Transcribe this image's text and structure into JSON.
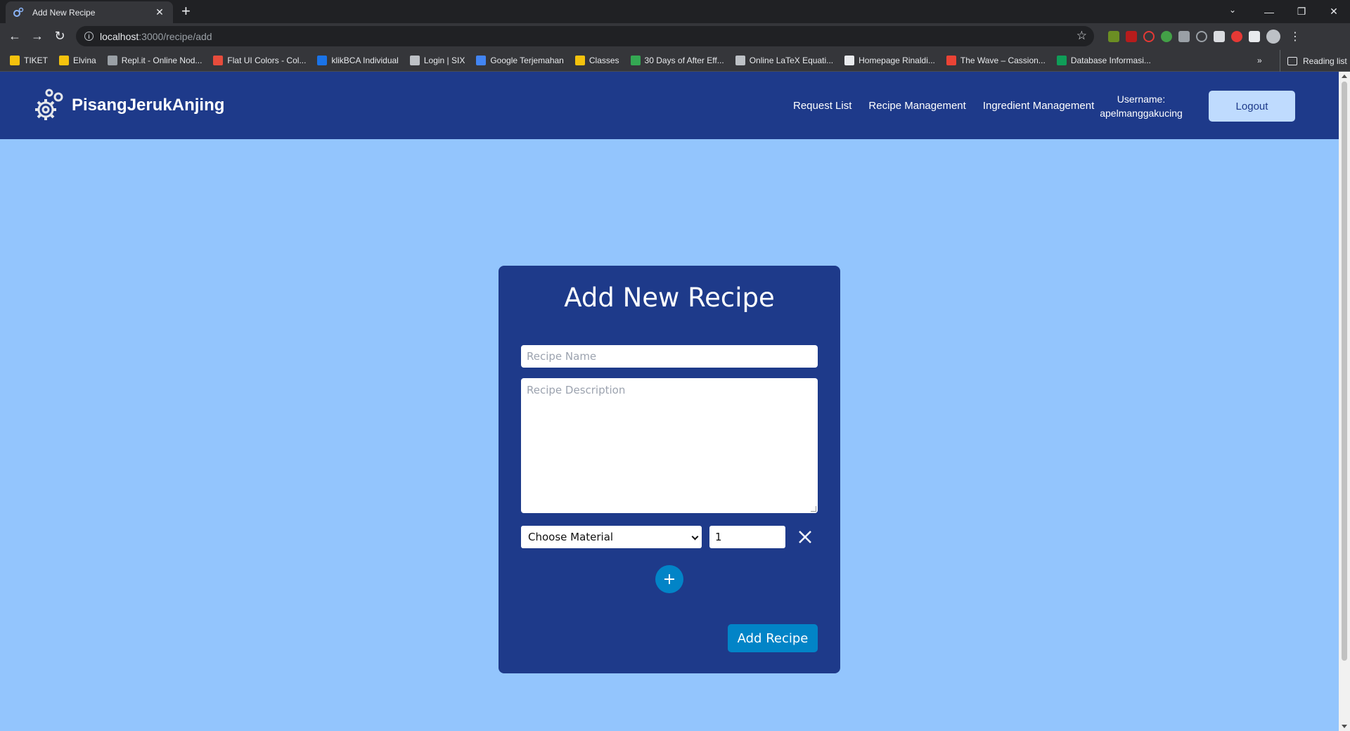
{
  "browser": {
    "tab_title": "Add New Recipe",
    "url_host": "localhost",
    "url_path": ":3000/recipe/add",
    "bookmarks": [
      {
        "label": "TIKET",
        "color": "#f4c20d"
      },
      {
        "label": "Elvina",
        "color": "#f4c20d"
      },
      {
        "label": "Repl.it - Online Nod...",
        "color": "#9aa0a6"
      },
      {
        "label": "Flat UI Colors - Col...",
        "color": "#e74c3c"
      },
      {
        "label": "klikBCA Individual",
        "color": "#1a73e8"
      },
      {
        "label": "Login | SIX",
        "color": "#bdc1c6"
      },
      {
        "label": "Google Terjemahan",
        "color": "#4285f4"
      },
      {
        "label": "Classes",
        "color": "#f4c20d"
      },
      {
        "label": "30 Days of After Eff...",
        "color": "#34a853"
      },
      {
        "label": "Online LaTeX Equati...",
        "color": "#bdc1c6"
      },
      {
        "label": "Homepage Rinaldi...",
        "color": "#e8eaed"
      },
      {
        "label": "The Wave – Cassion...",
        "color": "#ea4335"
      },
      {
        "label": "Database Informasi...",
        "color": "#0f9d58"
      }
    ],
    "more_bookmarks": "»",
    "reading_list": "Reading list"
  },
  "navbar": {
    "brand": "PisangJerukAnjing",
    "links": [
      "Request List",
      "Recipe Management",
      "Ingredient Management"
    ],
    "username_label": "Username:",
    "username": "apelmanggakucing",
    "logout": "Logout"
  },
  "form": {
    "title": "Add New Recipe",
    "name_placeholder": "Recipe Name",
    "description_placeholder": "Recipe Description",
    "material_selected": "Choose Material",
    "quantity": "1",
    "submit": "Add Recipe"
  },
  "colors": {
    "navbar_bg": "#1e3a8a",
    "page_bg": "#93c5fd",
    "accent_button": "#0284c7",
    "logout_bg": "#bfdbfe"
  }
}
